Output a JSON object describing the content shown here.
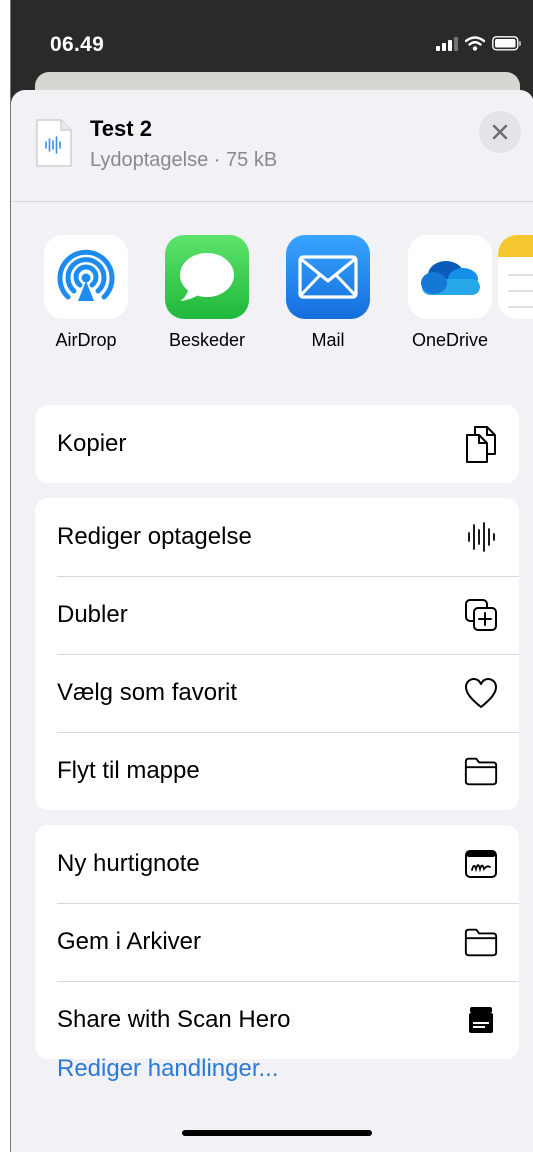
{
  "status_bar": {
    "time": "06.49",
    "icons": [
      "signal-icon",
      "wifi-icon",
      "battery-icon"
    ]
  },
  "file": {
    "title": "Test 2",
    "subtitle": "Lydoptagelse · 75 kB",
    "icon": "audio-file-icon"
  },
  "close": {
    "icon": "close-icon"
  },
  "share_targets": [
    {
      "label": "AirDrop",
      "icon": "airdrop-icon"
    },
    {
      "label": "Beskeder",
      "icon": "messages-icon"
    },
    {
      "label": "Mail",
      "icon": "mail-icon"
    },
    {
      "label": "OneDrive",
      "icon": "onedrive-icon"
    },
    {
      "label": "",
      "icon": "notes-icon"
    }
  ],
  "actions": {
    "group1": [
      {
        "label": "Kopier",
        "icon": "copy-icon"
      }
    ],
    "group2": [
      {
        "label": "Rediger optagelse",
        "icon": "waveform-icon"
      },
      {
        "label": "Dubler",
        "icon": "duplicate-icon"
      },
      {
        "label": "Vælg som favorit",
        "icon": "heart-icon"
      },
      {
        "label": "Flyt til mappe",
        "icon": "folder-icon"
      }
    ],
    "group3": [
      {
        "label": "Ny hurtignote",
        "icon": "quick-note-icon"
      },
      {
        "label": "Gem i Arkiver",
        "icon": "folder-icon"
      },
      {
        "label": "Share with Scan Hero",
        "icon": "scan-hero-icon"
      }
    ]
  },
  "edit_actions_label": "Rediger handlinger...",
  "colors": {
    "accent": "#2b7ad8",
    "messages_green": "#34c759",
    "mail_blue": "#1e88f0",
    "sheet_bg": "#f2f2f6"
  }
}
